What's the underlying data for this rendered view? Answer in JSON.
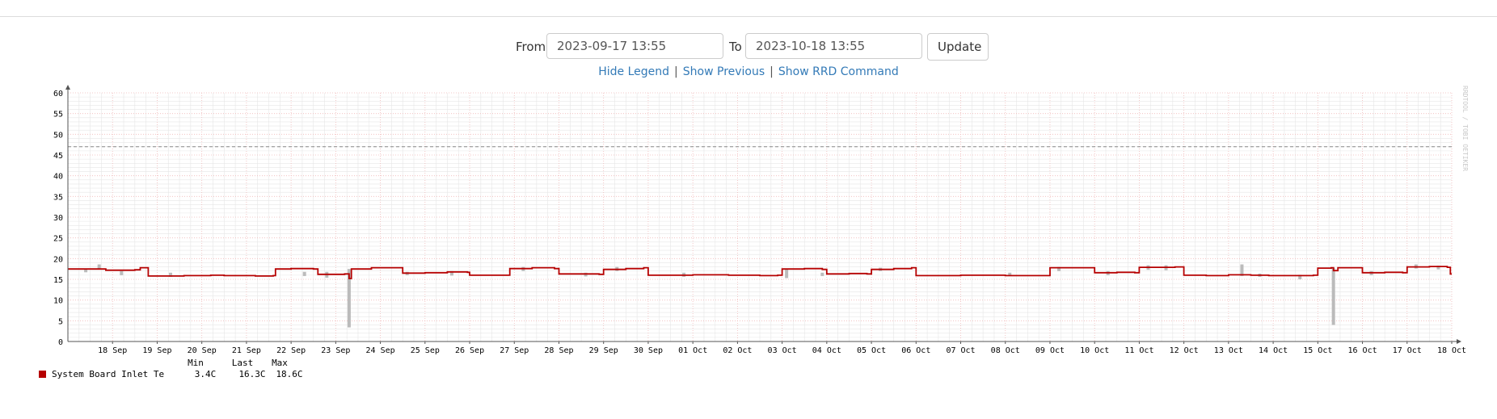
{
  "controls": {
    "from_label": "From",
    "from_value": "2023-09-17 13:55",
    "to_label": "To",
    "to_value": "2023-10-18 13:55",
    "update_label": "Update"
  },
  "links": {
    "hide_legend": "Hide Legend",
    "show_previous": "Show Previous",
    "show_rrd_command": "Show RRD Command",
    "separator": "|"
  },
  "colors": {
    "series_line": "#b60000",
    "series_band": "#bbbbbb",
    "grid_major": "#f0b9b9",
    "grid_minor": "#e6e6e6",
    "threshold": "#888888",
    "axis": "#555555"
  },
  "chart_data": {
    "type": "line",
    "watermark": "RRDTOOL / TOBI OETIKER",
    "ylim": [
      0,
      60
    ],
    "yticks": [
      0,
      5,
      10,
      15,
      20,
      25,
      30,
      35,
      40,
      45,
      50,
      55,
      60
    ],
    "x_range": [
      "2023-09-17 13:55",
      "2023-10-18 13:55"
    ],
    "x_ticks": [
      {
        "day": 1,
        "label": "18 Sep"
      },
      {
        "day": 2,
        "label": "19 Sep"
      },
      {
        "day": 3,
        "label": "20 Sep"
      },
      {
        "day": 4,
        "label": "21 Sep"
      },
      {
        "day": 5,
        "label": "22 Sep"
      },
      {
        "day": 6,
        "label": "23 Sep"
      },
      {
        "day": 7,
        "label": "24 Sep"
      },
      {
        "day": 8,
        "label": "25 Sep"
      },
      {
        "day": 9,
        "label": "26 Sep"
      },
      {
        "day": 10,
        "label": "27 Sep"
      },
      {
        "day": 11,
        "label": "28 Sep"
      },
      {
        "day": 12,
        "label": "29 Sep"
      },
      {
        "day": 13,
        "label": "30 Sep"
      },
      {
        "day": 14,
        "label": "01 Oct"
      },
      {
        "day": 15,
        "label": "02 Oct"
      },
      {
        "day": 16,
        "label": "03 Oct"
      },
      {
        "day": 17,
        "label": "04 Oct"
      },
      {
        "day": 18,
        "label": "05 Oct"
      },
      {
        "day": 19,
        "label": "06 Oct"
      },
      {
        "day": 20,
        "label": "07 Oct"
      },
      {
        "day": 21,
        "label": "08 Oct"
      },
      {
        "day": 22,
        "label": "09 Oct"
      },
      {
        "day": 23,
        "label": "10 Oct"
      },
      {
        "day": 24,
        "label": "11 Oct"
      },
      {
        "day": 25,
        "label": "12 Oct"
      },
      {
        "day": 26,
        "label": "13 Oct"
      },
      {
        "day": 27,
        "label": "14 Oct"
      },
      {
        "day": 28,
        "label": "15 Oct"
      },
      {
        "day": 29,
        "label": "16 Oct"
      },
      {
        "day": 30,
        "label": "17 Oct"
      },
      {
        "day": 31,
        "label": "18 Oct"
      }
    ],
    "threshold": 47,
    "series": [
      {
        "name": "System Board Inlet Te",
        "points": [
          [
            0.0,
            17.5
          ],
          [
            0.8,
            17.5
          ],
          [
            0.85,
            17.2
          ],
          [
            1.5,
            17.3
          ],
          [
            1.62,
            17.8
          ],
          [
            1.75,
            17.8
          ],
          [
            1.8,
            15.8
          ],
          [
            2.6,
            15.9
          ],
          [
            3.2,
            16.0
          ],
          [
            3.5,
            15.9
          ],
          [
            4.2,
            15.8
          ],
          [
            4.6,
            15.9
          ],
          [
            4.65,
            17.5
          ],
          [
            5.0,
            17.6
          ],
          [
            5.5,
            17.5
          ],
          [
            5.6,
            16.2
          ],
          [
            6.2,
            16.3
          ],
          [
            6.3,
            15.2
          ],
          [
            6.35,
            17.5
          ],
          [
            6.8,
            17.8
          ],
          [
            7.4,
            17.8
          ],
          [
            7.5,
            16.5
          ],
          [
            8.0,
            16.6
          ],
          [
            8.5,
            16.8
          ],
          [
            8.95,
            16.7
          ],
          [
            9.0,
            16.0
          ],
          [
            9.8,
            16.0
          ],
          [
            9.9,
            17.6
          ],
          [
            10.4,
            17.8
          ],
          [
            10.9,
            17.6
          ],
          [
            11.0,
            16.3
          ],
          [
            11.9,
            16.2
          ],
          [
            12.0,
            17.4
          ],
          [
            12.5,
            17.6
          ],
          [
            12.9,
            17.8
          ],
          [
            13.0,
            16.0
          ],
          [
            14.0,
            16.1
          ],
          [
            14.8,
            16.0
          ],
          [
            15.5,
            15.9
          ],
          [
            15.9,
            16.0
          ],
          [
            16.0,
            17.5
          ],
          [
            16.5,
            17.6
          ],
          [
            16.9,
            17.4
          ],
          [
            17.0,
            16.3
          ],
          [
            17.5,
            16.4
          ],
          [
            17.9,
            16.3
          ],
          [
            18.0,
            17.4
          ],
          [
            18.5,
            17.6
          ],
          [
            18.9,
            17.8
          ],
          [
            19.0,
            15.9
          ],
          [
            20.0,
            16.0
          ],
          [
            21.0,
            15.9
          ],
          [
            21.9,
            15.9
          ],
          [
            22.0,
            17.8
          ],
          [
            22.9,
            17.8
          ],
          [
            23.0,
            16.6
          ],
          [
            23.5,
            16.7
          ],
          [
            23.9,
            16.6
          ],
          [
            24.0,
            17.9
          ],
          [
            24.8,
            18.0
          ],
          [
            24.95,
            18.0
          ],
          [
            25.0,
            16.0
          ],
          [
            25.5,
            15.9
          ],
          [
            26.0,
            16.1
          ],
          [
            26.5,
            16.0
          ],
          [
            26.9,
            15.9
          ],
          [
            27.0,
            15.9
          ],
          [
            27.9,
            16.0
          ],
          [
            28.0,
            17.7
          ],
          [
            28.3,
            17.8
          ],
          [
            28.35,
            17.1
          ],
          [
            28.45,
            17.8
          ],
          [
            28.9,
            17.8
          ],
          [
            29.0,
            16.6
          ],
          [
            29.5,
            16.7
          ],
          [
            29.9,
            16.6
          ],
          [
            30.0,
            18.0
          ],
          [
            30.5,
            18.1
          ],
          [
            30.9,
            17.9
          ],
          [
            30.97,
            16.3
          ],
          [
            31.0,
            16.3
          ]
        ],
        "band": [
          [
            0.4,
            16.7,
            17.6
          ],
          [
            0.7,
            17.6,
            18.6
          ],
          [
            1.2,
            16.0,
            17.0
          ],
          [
            2.3,
            15.6,
            16.6
          ],
          [
            5.3,
            15.8,
            16.8
          ],
          [
            5.8,
            15.4,
            16.8
          ],
          [
            6.3,
            3.4,
            17.5
          ],
          [
            7.6,
            16.0,
            16.8
          ],
          [
            8.6,
            15.9,
            17.0
          ],
          [
            10.2,
            17.0,
            18.0
          ],
          [
            11.6,
            15.7,
            16.6
          ],
          [
            12.3,
            17.0,
            18.0
          ],
          [
            13.8,
            15.6,
            16.6
          ],
          [
            16.1,
            15.3,
            17.6
          ],
          [
            16.9,
            15.8,
            16.6
          ],
          [
            18.2,
            17.0,
            17.8
          ],
          [
            21.1,
            16.0,
            16.6
          ],
          [
            22.2,
            17.0,
            18.0
          ],
          [
            23.3,
            16.0,
            17.0
          ],
          [
            24.2,
            17.3,
            18.4
          ],
          [
            24.6,
            17.2,
            18.4
          ],
          [
            26.3,
            15.8,
            18.6
          ],
          [
            26.7,
            15.6,
            16.4
          ],
          [
            27.6,
            15.0,
            16.1
          ],
          [
            28.35,
            4.0,
            17.8
          ],
          [
            29.2,
            16.0,
            17.0
          ],
          [
            30.2,
            17.6,
            18.6
          ],
          [
            30.7,
            17.4,
            18.3
          ]
        ]
      }
    ],
    "legend": {
      "columns": [
        "Min",
        "Last",
        "Max"
      ],
      "entries": [
        {
          "label": "System Board Inlet Te",
          "min": "3.4C",
          "last": "16.3C",
          "max": "18.6C"
        }
      ]
    }
  }
}
